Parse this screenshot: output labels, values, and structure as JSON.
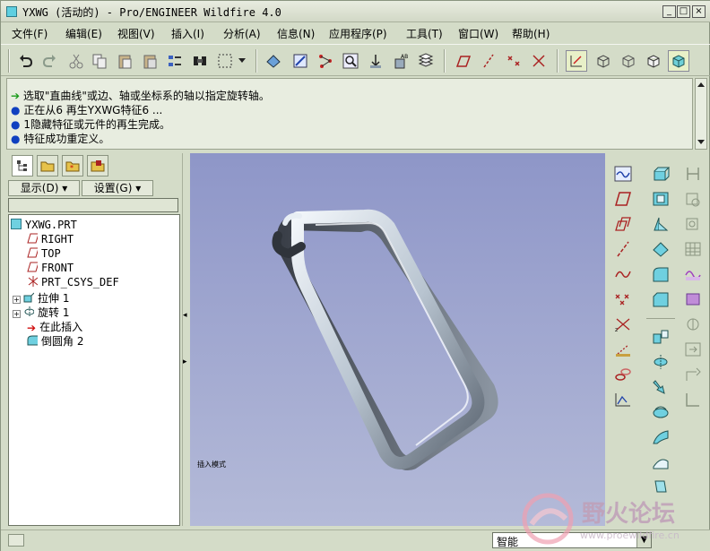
{
  "window": {
    "title": "YXWG (活动的) - Pro/ENGINEER Wildfire 4.0",
    "minimize_label": "_",
    "maximize_label": "□",
    "close_label": "×"
  },
  "menu": {
    "items": [
      "文件(F)",
      "编辑(E)",
      "视图(V)",
      "插入(I)",
      "分析(A)",
      "信息(N)",
      "应用程序(P)",
      "工具(T)",
      "窗口(W)",
      "帮助(H)"
    ]
  },
  "messages": {
    "lines": [
      "选取\"直曲线\"或边、轴或坐标系的轴以指定旋转轴。",
      "正在从6 再生YXWG特征6 ...",
      "1隐藏特征或元件的再生完成。",
      "特征成功重定义。"
    ]
  },
  "navigator": {
    "show_button": "显示(D)",
    "settings_button": "设置(G)",
    "tree": [
      "YXWG.PRT",
      "RIGHT",
      "TOP",
      "FRONT",
      "PRT_CSYS_DEF",
      "拉伸 1",
      "旋转 1",
      "在此插入",
      "倒圆角 2"
    ]
  },
  "viewport": {
    "annotation": "插入模式"
  },
  "status": {
    "filter_value": "智能"
  },
  "watermark": {
    "text": "野火论坛",
    "url": "www.proewildfire.cn"
  },
  "colors": {
    "ui_bg": "#d4dcc8",
    "viewport_top": "#8e96c8",
    "viewport_bottom": "#b4bad8",
    "model": "#b8c4d0"
  }
}
